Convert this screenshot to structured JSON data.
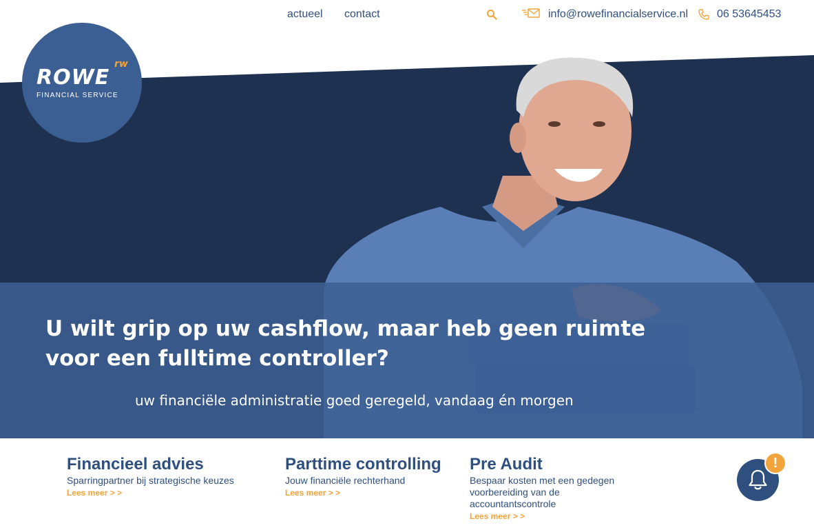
{
  "nav": {
    "actueel": "actueel",
    "contact": "contact",
    "email": "info@rowefinancialservice.nl",
    "phone": "06 53645453",
    "icons": [
      "search-icon",
      "mail-icon",
      "phone-icon"
    ]
  },
  "logo": {
    "word": "ROWE",
    "mark": "rw",
    "subtitle": "FINANCIAL SERVICE"
  },
  "hero": {
    "title": "U wilt grip op uw cashflow, maar heb geen ruimte voor een fulltime controller?",
    "subtitle": "uw financiële administratie goed geregeld, vandaag én morgen"
  },
  "services": [
    {
      "title": "Financieel advies",
      "description": "Sparringpartner bij strategische keuzes",
      "link": "Lees meer > >"
    },
    {
      "title": "Parttime controlling",
      "description": "Jouw financiële rechterhand",
      "link": "Lees meer > >"
    },
    {
      "title": "Pre Audit",
      "description": "Bespaar kosten met een gedegen voorbereiding van de accountantscontrole",
      "link": "Lees meer > >"
    }
  ],
  "notification": {
    "badge": "!",
    "icon": "bell-icon"
  },
  "colors": {
    "navy": "#1f3150",
    "band": "#3b5e93",
    "accent": "#f2a33a",
    "text": "#2f4f7f"
  }
}
